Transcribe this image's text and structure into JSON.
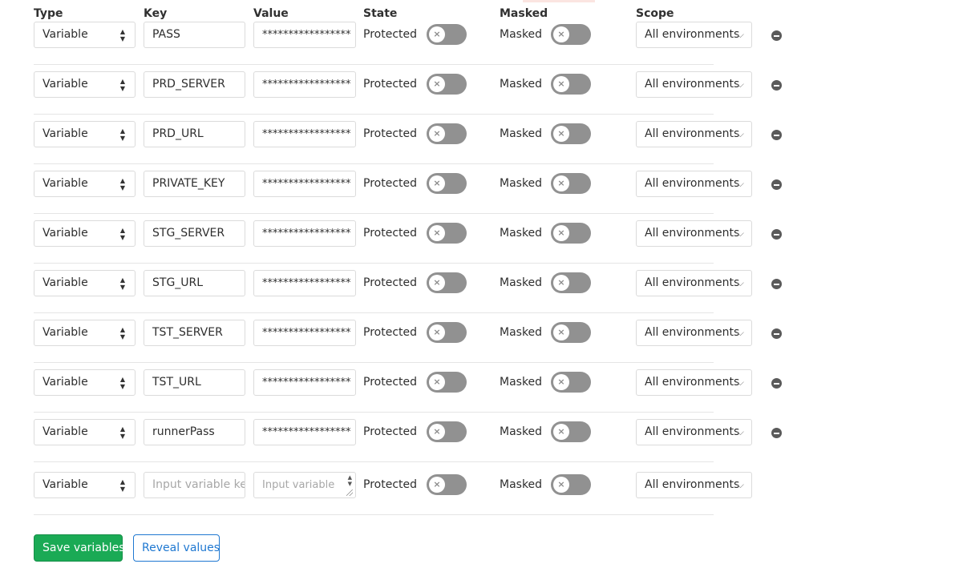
{
  "headers": {
    "type": "Type",
    "key": "Key",
    "value": "Value",
    "state": "State",
    "masked": "Masked",
    "scope": "Scope"
  },
  "colors": {
    "toggle_off": "#919191",
    "save_button_bg": "#1aaa55",
    "reveal_button_border": "#1f78d1"
  },
  "variables": [
    {
      "type": "Variable",
      "key": "PASS",
      "value": "*****************",
      "protected_label": "Protected",
      "masked_label": "Masked",
      "protected": false,
      "masked": false,
      "scope": "All environments"
    },
    {
      "type": "Variable",
      "key": "PRD_SERVER",
      "value": "*****************",
      "protected_label": "Protected",
      "masked_label": "Masked",
      "protected": false,
      "masked": false,
      "scope": "All environments"
    },
    {
      "type": "Variable",
      "key": "PRD_URL",
      "value": "*****************",
      "protected_label": "Protected",
      "masked_label": "Masked",
      "protected": false,
      "masked": false,
      "scope": "All environments"
    },
    {
      "type": "Variable",
      "key": "PRIVATE_KEY",
      "value": "*****************",
      "protected_label": "Protected",
      "masked_label": "Masked",
      "protected": false,
      "masked": false,
      "scope": "All environments"
    },
    {
      "type": "Variable",
      "key": "STG_SERVER",
      "value": "*****************",
      "protected_label": "Protected",
      "masked_label": "Masked",
      "protected": false,
      "masked": false,
      "scope": "All environments"
    },
    {
      "type": "Variable",
      "key": "STG_URL",
      "value": "*****************",
      "protected_label": "Protected",
      "masked_label": "Masked",
      "protected": false,
      "masked": false,
      "scope": "All environments"
    },
    {
      "type": "Variable",
      "key": "TST_SERVER",
      "value": "*****************",
      "protected_label": "Protected",
      "masked_label": "Masked",
      "protected": false,
      "masked": false,
      "scope": "All environments"
    },
    {
      "type": "Variable",
      "key": "TST_URL",
      "value": "*****************",
      "protected_label": "Protected",
      "masked_label": "Masked",
      "protected": false,
      "masked": false,
      "scope": "All environments"
    },
    {
      "type": "Variable",
      "key": "runnerPass",
      "value": "*****************",
      "protected_label": "Protected",
      "masked_label": "Masked",
      "protected": false,
      "masked": false,
      "scope": "All environments"
    }
  ],
  "new_row": {
    "type": "Variable",
    "key_placeholder": "Input variable ke",
    "value_placeholder": "Input variable",
    "protected_label": "Protected",
    "masked_label": "Masked",
    "protected": false,
    "masked": false,
    "scope": "All environments"
  },
  "actions": {
    "save_label": "Save variables",
    "reveal_label": "Reveal values"
  }
}
